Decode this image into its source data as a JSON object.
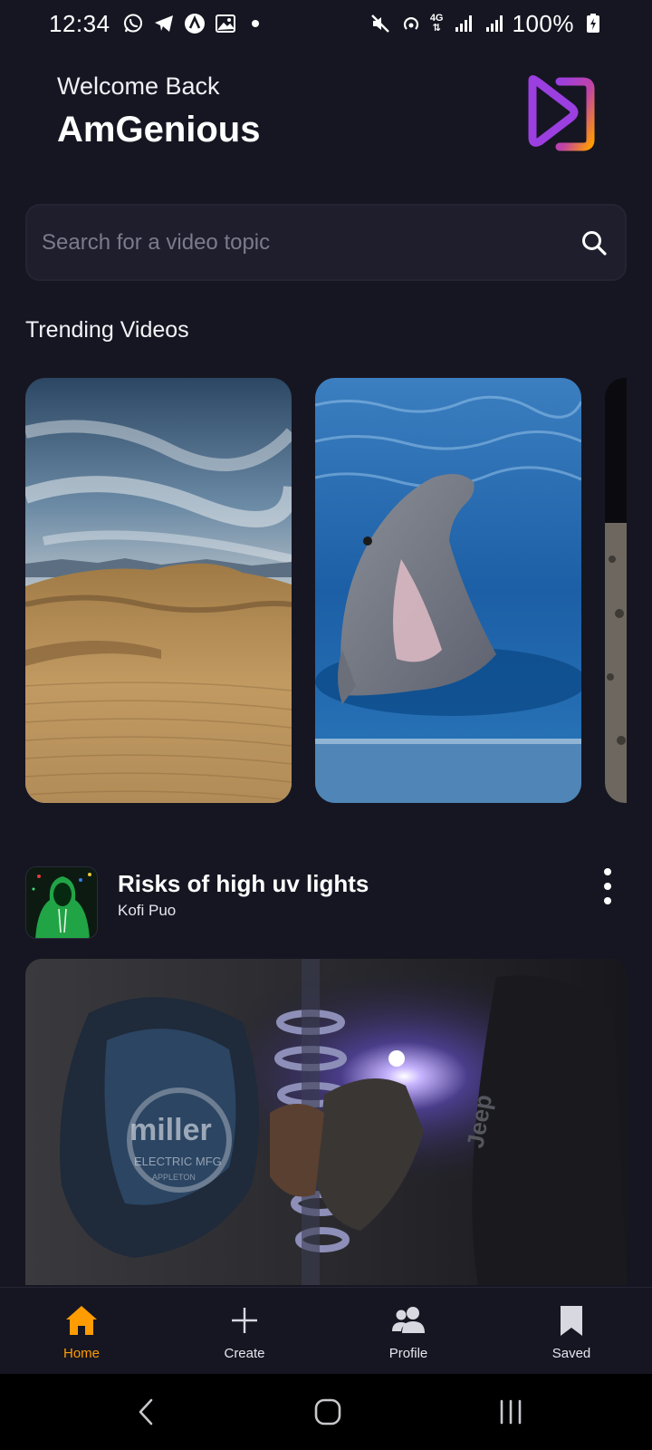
{
  "status_bar": {
    "time": "12:34",
    "battery": "100%",
    "network": "4G",
    "left_icons": [
      "whatsapp-icon",
      "telegram-icon",
      "app-icon",
      "gallery-icon"
    ],
    "right_icons": [
      "mute-icon",
      "hotspot-icon",
      "signal-icon",
      "battery-icon"
    ]
  },
  "header": {
    "greeting": "Welcome Back",
    "username": "AmGenious",
    "logo_icon": "app-logo-icon",
    "logo_colors": [
      "#9b3fe0",
      "#ff9c01"
    ]
  },
  "search": {
    "placeholder": "Search for a video topic",
    "value": "",
    "icon": "search-icon"
  },
  "trending": {
    "title": "Trending Videos",
    "cards": [
      {
        "image": "desert-dunes-thumbnail"
      },
      {
        "image": "dolphin-thumbnail"
      },
      {
        "image": "lunar-surface-thumbnail"
      }
    ]
  },
  "post": {
    "title": "Risks of high uv lights",
    "author": "Kofi Puo",
    "avatar": "hooded-figure-avatar",
    "thumbnail": "welder-thumbnail",
    "thumbnail_texts": [
      "miller",
      "ELECTRIC MFG",
      "APPLETON",
      "Jeep"
    ]
  },
  "tabs": [
    {
      "label": "Home",
      "icon": "home-icon",
      "active": true
    },
    {
      "label": "Create",
      "icon": "plus-icon",
      "active": false
    },
    {
      "label": "Profile",
      "icon": "users-icon",
      "active": false
    },
    {
      "label": "Saved",
      "icon": "bookmark-icon",
      "active": false
    }
  ],
  "colors": {
    "background": "#161622",
    "accent": "#ff9c01",
    "surface": "#1e1e2d",
    "muted_text": "#7b7b8b"
  }
}
